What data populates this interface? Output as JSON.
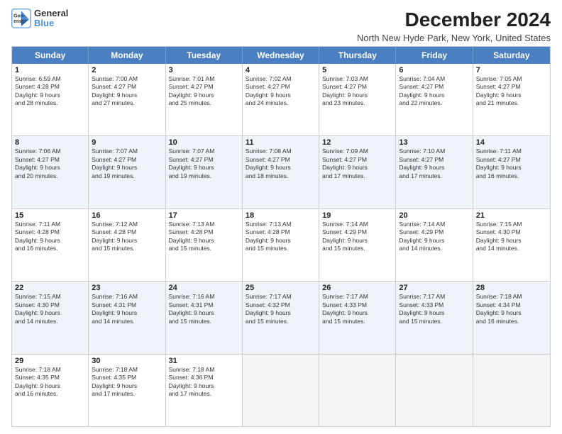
{
  "logo": {
    "line1": "General",
    "line2": "Blue"
  },
  "title": "December 2024",
  "subtitle": "North New Hyde Park, New York, United States",
  "weekdays": [
    "Sunday",
    "Monday",
    "Tuesday",
    "Wednesday",
    "Thursday",
    "Friday",
    "Saturday"
  ],
  "rows": [
    [
      {
        "day": "1",
        "lines": [
          "Sunrise: 6:59 AM",
          "Sunset: 4:28 PM",
          "Daylight: 9 hours",
          "and 28 minutes."
        ]
      },
      {
        "day": "2",
        "lines": [
          "Sunrise: 7:00 AM",
          "Sunset: 4:27 PM",
          "Daylight: 9 hours",
          "and 27 minutes."
        ]
      },
      {
        "day": "3",
        "lines": [
          "Sunrise: 7:01 AM",
          "Sunset: 4:27 PM",
          "Daylight: 9 hours",
          "and 25 minutes."
        ]
      },
      {
        "day": "4",
        "lines": [
          "Sunrise: 7:02 AM",
          "Sunset: 4:27 PM",
          "Daylight: 9 hours",
          "and 24 minutes."
        ]
      },
      {
        "day": "5",
        "lines": [
          "Sunrise: 7:03 AM",
          "Sunset: 4:27 PM",
          "Daylight: 9 hours",
          "and 23 minutes."
        ]
      },
      {
        "day": "6",
        "lines": [
          "Sunrise: 7:04 AM",
          "Sunset: 4:27 PM",
          "Daylight: 9 hours",
          "and 22 minutes."
        ]
      },
      {
        "day": "7",
        "lines": [
          "Sunrise: 7:05 AM",
          "Sunset: 4:27 PM",
          "Daylight: 9 hours",
          "and 21 minutes."
        ]
      }
    ],
    [
      {
        "day": "8",
        "lines": [
          "Sunrise: 7:06 AM",
          "Sunset: 4:27 PM",
          "Daylight: 9 hours",
          "and 20 minutes."
        ]
      },
      {
        "day": "9",
        "lines": [
          "Sunrise: 7:07 AM",
          "Sunset: 4:27 PM",
          "Daylight: 9 hours",
          "and 19 minutes."
        ]
      },
      {
        "day": "10",
        "lines": [
          "Sunrise: 7:07 AM",
          "Sunset: 4:27 PM",
          "Daylight: 9 hours",
          "and 19 minutes."
        ]
      },
      {
        "day": "11",
        "lines": [
          "Sunrise: 7:08 AM",
          "Sunset: 4:27 PM",
          "Daylight: 9 hours",
          "and 18 minutes."
        ]
      },
      {
        "day": "12",
        "lines": [
          "Sunrise: 7:09 AM",
          "Sunset: 4:27 PM",
          "Daylight: 9 hours",
          "and 17 minutes."
        ]
      },
      {
        "day": "13",
        "lines": [
          "Sunrise: 7:10 AM",
          "Sunset: 4:27 PM",
          "Daylight: 9 hours",
          "and 17 minutes."
        ]
      },
      {
        "day": "14",
        "lines": [
          "Sunrise: 7:11 AM",
          "Sunset: 4:27 PM",
          "Daylight: 9 hours",
          "and 16 minutes."
        ]
      }
    ],
    [
      {
        "day": "15",
        "lines": [
          "Sunrise: 7:11 AM",
          "Sunset: 4:28 PM",
          "Daylight: 9 hours",
          "and 16 minutes."
        ]
      },
      {
        "day": "16",
        "lines": [
          "Sunrise: 7:12 AM",
          "Sunset: 4:28 PM",
          "Daylight: 9 hours",
          "and 15 minutes."
        ]
      },
      {
        "day": "17",
        "lines": [
          "Sunrise: 7:13 AM",
          "Sunset: 4:28 PM",
          "Daylight: 9 hours",
          "and 15 minutes."
        ]
      },
      {
        "day": "18",
        "lines": [
          "Sunrise: 7:13 AM",
          "Sunset: 4:28 PM",
          "Daylight: 9 hours",
          "and 15 minutes."
        ]
      },
      {
        "day": "19",
        "lines": [
          "Sunrise: 7:14 AM",
          "Sunset: 4:29 PM",
          "Daylight: 9 hours",
          "and 15 minutes."
        ]
      },
      {
        "day": "20",
        "lines": [
          "Sunrise: 7:14 AM",
          "Sunset: 4:29 PM",
          "Daylight: 9 hours",
          "and 14 minutes."
        ]
      },
      {
        "day": "21",
        "lines": [
          "Sunrise: 7:15 AM",
          "Sunset: 4:30 PM",
          "Daylight: 9 hours",
          "and 14 minutes."
        ]
      }
    ],
    [
      {
        "day": "22",
        "lines": [
          "Sunrise: 7:15 AM",
          "Sunset: 4:30 PM",
          "Daylight: 9 hours",
          "and 14 minutes."
        ]
      },
      {
        "day": "23",
        "lines": [
          "Sunrise: 7:16 AM",
          "Sunset: 4:31 PM",
          "Daylight: 9 hours",
          "and 14 minutes."
        ]
      },
      {
        "day": "24",
        "lines": [
          "Sunrise: 7:16 AM",
          "Sunset: 4:31 PM",
          "Daylight: 9 hours",
          "and 15 minutes."
        ]
      },
      {
        "day": "25",
        "lines": [
          "Sunrise: 7:17 AM",
          "Sunset: 4:32 PM",
          "Daylight: 9 hours",
          "and 15 minutes."
        ]
      },
      {
        "day": "26",
        "lines": [
          "Sunrise: 7:17 AM",
          "Sunset: 4:33 PM",
          "Daylight: 9 hours",
          "and 15 minutes."
        ]
      },
      {
        "day": "27",
        "lines": [
          "Sunrise: 7:17 AM",
          "Sunset: 4:33 PM",
          "Daylight: 9 hours",
          "and 15 minutes."
        ]
      },
      {
        "day": "28",
        "lines": [
          "Sunrise: 7:18 AM",
          "Sunset: 4:34 PM",
          "Daylight: 9 hours",
          "and 16 minutes."
        ]
      }
    ],
    [
      {
        "day": "29",
        "lines": [
          "Sunrise: 7:18 AM",
          "Sunset: 4:35 PM",
          "Daylight: 9 hours",
          "and 16 minutes."
        ]
      },
      {
        "day": "30",
        "lines": [
          "Sunrise: 7:18 AM",
          "Sunset: 4:35 PM",
          "Daylight: 9 hours",
          "and 17 minutes."
        ]
      },
      {
        "day": "31",
        "lines": [
          "Sunrise: 7:18 AM",
          "Sunset: 4:36 PM",
          "Daylight: 9 hours",
          "and 17 minutes."
        ]
      },
      {
        "day": "",
        "lines": []
      },
      {
        "day": "",
        "lines": []
      },
      {
        "day": "",
        "lines": []
      },
      {
        "day": "",
        "lines": []
      }
    ]
  ]
}
